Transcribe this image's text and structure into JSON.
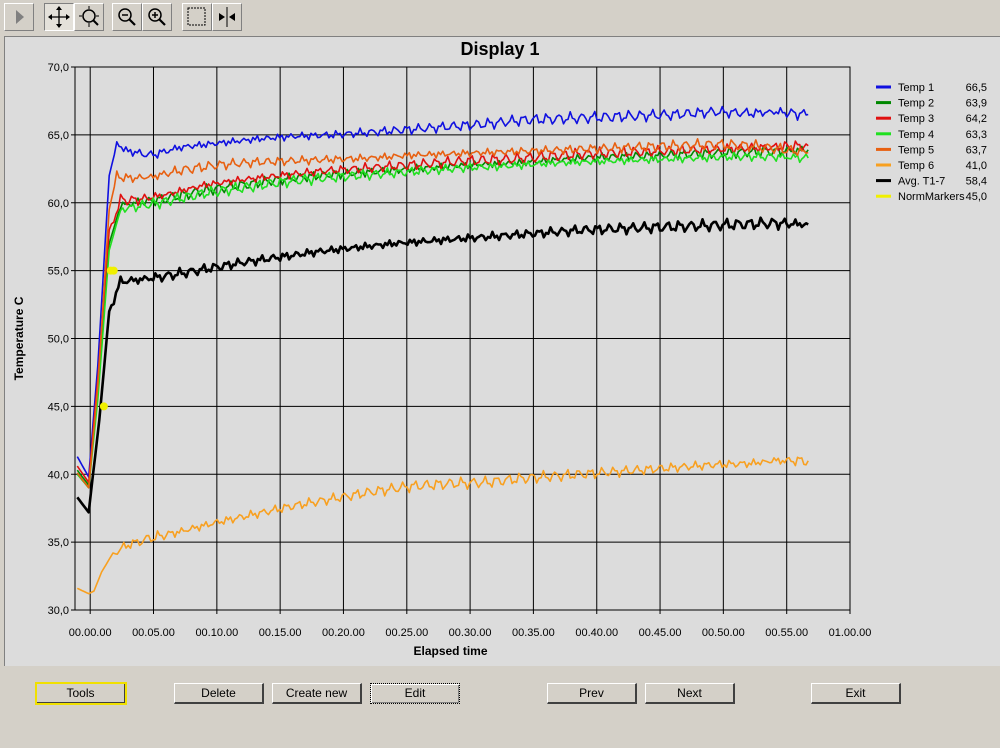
{
  "toolbar": {
    "buttons": [
      {
        "icon": "play-icon"
      },
      {
        "icon": "pan-icon"
      },
      {
        "icon": "zoom-region-icon"
      },
      {
        "icon": "zoom-out-icon"
      },
      {
        "icon": "zoom-in-icon"
      },
      {
        "icon": "select-box-icon"
      },
      {
        "icon": "cursor-icon"
      }
    ]
  },
  "chart_data": {
    "type": "line",
    "title": "Display 1",
    "xlabel": "Elapsed time",
    "ylabel": "Temperature C",
    "ylim": [
      30,
      70
    ],
    "xlim": [
      -0.02,
      1.0
    ],
    "grid": true,
    "legend_position": "right",
    "y_ticks": [
      "30,0",
      "35,0",
      "40,0",
      "45,0",
      "50,0",
      "55,0",
      "60,0",
      "65,0",
      "70,0"
    ],
    "x_ticks": [
      "00.00.00",
      "00.05.00",
      "00.10.00",
      "00.15.00",
      "00.20.00",
      "00.25.00",
      "00.30.00",
      "00.35.00",
      "00.40.00",
      "00.45.00",
      "00.50.00",
      "00.55.00",
      "01.00.00"
    ],
    "x_tick_values": [
      0.0,
      0.0833,
      0.1667,
      0.25,
      0.3333,
      0.4167,
      0.5,
      0.5833,
      0.6667,
      0.75,
      0.8333,
      0.9167,
      1.0
    ],
    "series": [
      {
        "name": "Temp 1",
        "value_label": "66,5",
        "color": "#1010e0",
        "x": [
          -0.017,
          -0.002,
          0.01,
          0.025,
          0.035,
          0.05,
          0.08,
          0.12,
          0.17,
          0.22,
          0.27,
          0.32,
          0.37,
          0.42,
          0.47,
          0.52,
          0.57,
          0.62,
          0.67,
          0.72,
          0.77,
          0.82,
          0.87,
          0.9,
          0.945
        ],
        "y": [
          41.3,
          39.8,
          48,
          62,
          64.3,
          63.8,
          63.5,
          64.1,
          64.4,
          64.7,
          64.9,
          65.0,
          65.2,
          65.4,
          65.6,
          65.8,
          66.1,
          66.2,
          66.3,
          66.4,
          66.5,
          66.7,
          66.6,
          66.7,
          66.5
        ]
      },
      {
        "name": "Temp 2",
        "value_label": "63,9",
        "color": "#008800",
        "x": [
          -0.017,
          -0.002,
          0.01,
          0.025,
          0.04,
          0.06,
          0.1,
          0.15,
          0.2,
          0.25,
          0.3,
          0.35,
          0.4,
          0.45,
          0.5,
          0.55,
          0.6,
          0.65,
          0.7,
          0.75,
          0.8,
          0.85,
          0.9,
          0.945
        ],
        "y": [
          40.3,
          39.2,
          46,
          57,
          59.8,
          60.0,
          60.3,
          60.9,
          61.3,
          61.7,
          62.0,
          62.2,
          62.4,
          62.6,
          62.8,
          62.9,
          63.1,
          63.3,
          63.4,
          63.5,
          63.6,
          63.7,
          63.8,
          63.9
        ]
      },
      {
        "name": "Temp 3",
        "value_label": "64,2",
        "color": "#e01010",
        "x": [
          -0.017,
          -0.002,
          0.01,
          0.025,
          0.04,
          0.06,
          0.1,
          0.15,
          0.2,
          0.25,
          0.3,
          0.35,
          0.4,
          0.45,
          0.5,
          0.55,
          0.6,
          0.65,
          0.7,
          0.75,
          0.8,
          0.85,
          0.9,
          0.945
        ],
        "y": [
          40.6,
          39.4,
          47,
          58,
          60.2,
          60.2,
          60.6,
          61.3,
          61.7,
          62.0,
          62.3,
          62.5,
          62.7,
          62.9,
          63.1,
          63.2,
          63.4,
          63.6,
          63.7,
          63.8,
          63.9,
          64.0,
          64.1,
          64.2
        ]
      },
      {
        "name": "Temp 4",
        "value_label": "63,3",
        "color": "#20e020",
        "x": [
          -0.017,
          -0.002,
          0.01,
          0.025,
          0.04,
          0.06,
          0.1,
          0.15,
          0.2,
          0.25,
          0.3,
          0.35,
          0.4,
          0.45,
          0.5,
          0.55,
          0.6,
          0.65,
          0.7,
          0.75,
          0.8,
          0.85,
          0.9,
          0.945
        ],
        "y": [
          40.0,
          39.0,
          45.5,
          56.5,
          59.5,
          59.7,
          60.1,
          60.7,
          61.1,
          61.5,
          61.8,
          62.0,
          62.2,
          62.4,
          62.6,
          62.7,
          62.9,
          63.0,
          63.1,
          63.2,
          63.3,
          63.4,
          63.4,
          63.3
        ]
      },
      {
        "name": "Temp 5",
        "value_label": "63,7",
        "color": "#e86010",
        "x": [
          -0.017,
          -0.002,
          0.01,
          0.025,
          0.035,
          0.05,
          0.08,
          0.12,
          0.17,
          0.22,
          0.27,
          0.32,
          0.37,
          0.42,
          0.47,
          0.52,
          0.57,
          0.62,
          0.67,
          0.72,
          0.77,
          0.82,
          0.87,
          0.9,
          0.945
        ],
        "y": [
          40.1,
          39.0,
          46.5,
          59.5,
          62.0,
          61.8,
          61.9,
          62.4,
          62.8,
          63.0,
          63.1,
          63.2,
          63.3,
          63.5,
          63.6,
          63.7,
          63.8,
          63.9,
          64.0,
          64.1,
          64.2,
          64.3,
          64.2,
          64.0,
          63.7
        ]
      },
      {
        "name": "Temp 6",
        "value_label": "41,0",
        "color": "#f8a020",
        "x": [
          -0.017,
          -0.002,
          0.005,
          0.015,
          0.03,
          0.05,
          0.08,
          0.12,
          0.17,
          0.22,
          0.27,
          0.32,
          0.37,
          0.42,
          0.47,
          0.52,
          0.57,
          0.62,
          0.67,
          0.72,
          0.77,
          0.82,
          0.87,
          0.9,
          0.945
        ],
        "y": [
          31.6,
          31.2,
          31.4,
          32.8,
          34.2,
          34.8,
          35.3,
          35.8,
          36.5,
          37.1,
          37.7,
          38.2,
          38.7,
          39.1,
          39.3,
          39.4,
          39.7,
          39.9,
          40.1,
          40.3,
          40.5,
          40.7,
          40.8,
          41.0,
          41.0
        ]
      },
      {
        "name": "Avg. T1-7",
        "value_label": "58,4",
        "color": "#000000",
        "x": [
          -0.017,
          -0.002,
          0.012,
          0.025,
          0.04,
          0.06,
          0.1,
          0.15,
          0.2,
          0.25,
          0.3,
          0.35,
          0.4,
          0.45,
          0.5,
          0.55,
          0.6,
          0.65,
          0.7,
          0.75,
          0.8,
          0.85,
          0.9,
          0.945
        ],
        "y": [
          38.3,
          37.2,
          44,
          52,
          54.2,
          54.3,
          54.6,
          55.1,
          55.6,
          56.0,
          56.4,
          56.7,
          57.0,
          57.2,
          57.4,
          57.6,
          57.8,
          58.0,
          58.1,
          58.2,
          58.3,
          58.4,
          58.5,
          58.4
        ]
      },
      {
        "name": "NormMarkers",
        "value_label": "45,0",
        "color": "#f0f000",
        "markers_only": true,
        "x": [
          0.018,
          0.027,
          0.031
        ],
        "y": [
          45.0,
          55.0,
          55.0
        ]
      }
    ]
  },
  "buttons": {
    "tools": "Tools",
    "delete": "Delete",
    "create_new": "Create new",
    "edit": "Edit",
    "prev": "Prev",
    "next": "Next",
    "exit": "Exit"
  }
}
